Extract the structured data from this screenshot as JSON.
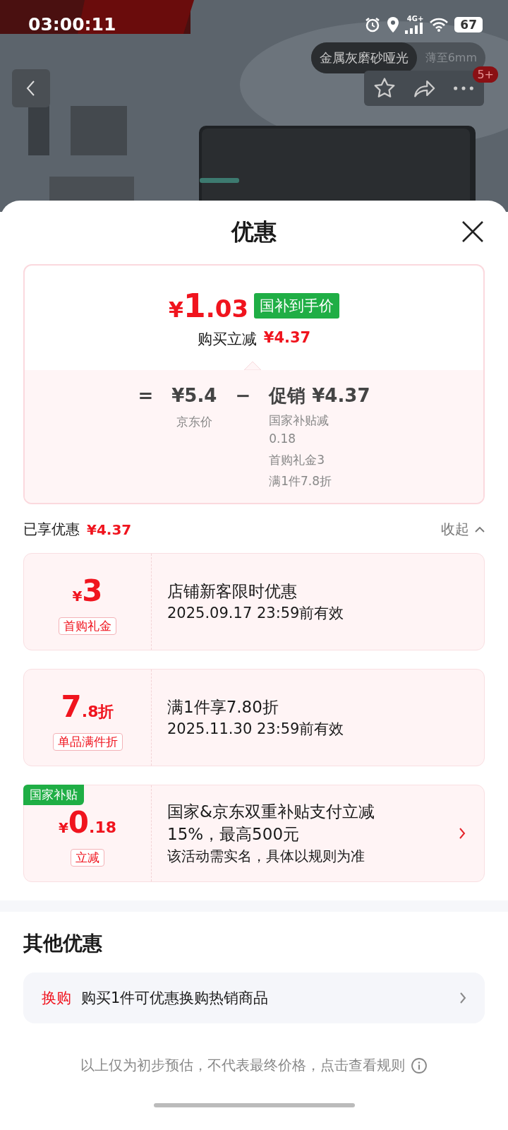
{
  "status_bar": {
    "time": "03:00:11",
    "network": "4G+",
    "battery": "67"
  },
  "product_header": {
    "tags": [
      {
        "label": "金属灰磨砂哑光",
        "selected": true
      },
      {
        "label": "薄至6mm",
        "selected": false
      }
    ],
    "message_badge": "5+"
  },
  "sheet": {
    "title": "优惠",
    "price_card": {
      "currency": "¥",
      "price_int": "1",
      "price_dec": ".03",
      "price_tag": "国补到手价",
      "instant_label": "购买立减",
      "instant_amount": "¥4.37",
      "equals": "=",
      "base_price": "¥5.4",
      "base_label": "京东价",
      "minus": "−",
      "promo_label": "促销",
      "promo_amount": "¥4.37",
      "promo_details": [
        "国家补贴减0.18",
        "首购礼金3",
        "满1件7.8折"
      ]
    },
    "summary": {
      "label": "已享优惠",
      "amount": "¥4.37",
      "toggle": "收起",
      "expanded": true
    },
    "coupons": [
      {
        "kind": "cash",
        "currency": "¥",
        "value": "3",
        "label": "首购礼金",
        "title": "店铺新客限时优惠",
        "subtitle": "2025.09.17 23:59前有效"
      },
      {
        "kind": "discount",
        "value": "7",
        "suffix": ".8折",
        "label": "单品满件折",
        "title": "满1件享7.80折",
        "subtitle": "2025.11.30 23:59前有效"
      },
      {
        "kind": "cash",
        "currency": "¥",
        "value": "0",
        "suffix": ".18",
        "label": "立减",
        "corner_badge": "国家补贴",
        "title": "国家&京东双重补贴支付立减15%，最高500元",
        "note": "该活动需实名，具体以规则为准",
        "has_arrow": true
      }
    ],
    "other": {
      "title": "其他优惠",
      "items": [
        {
          "tag": "换购",
          "text": "购买1件可优惠换购热销商品"
        }
      ]
    },
    "footer": "以上仅为初步预估，不代表最终价格，点击查看规则"
  }
}
